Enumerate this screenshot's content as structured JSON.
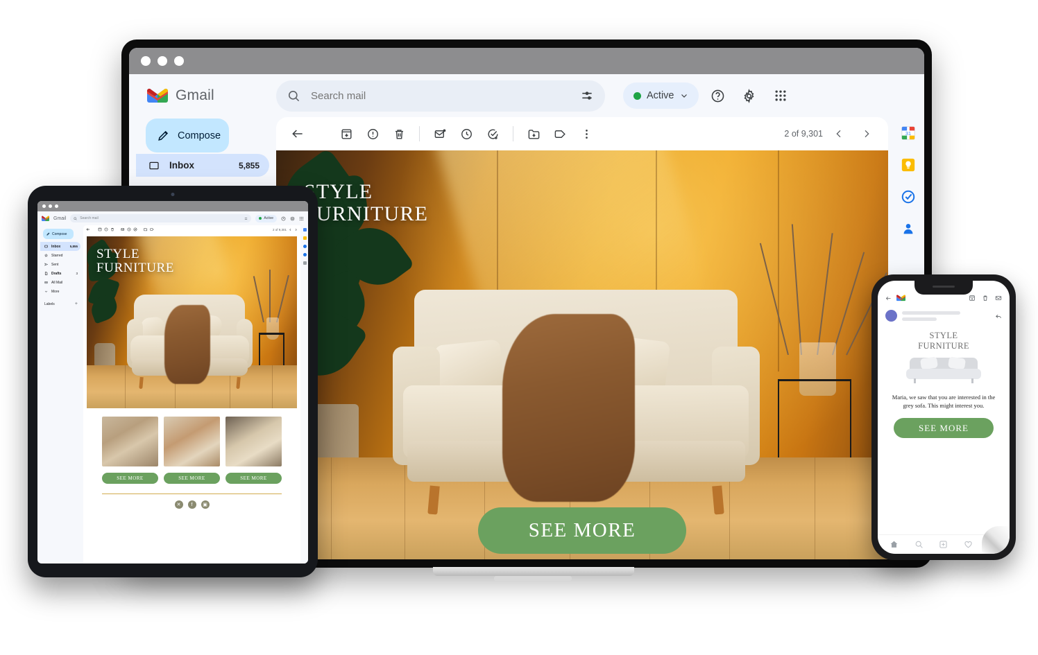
{
  "app": {
    "name": "Gmail",
    "logo_icon": "gmail-m-icon"
  },
  "search": {
    "placeholder": "Search mail",
    "value": "",
    "search_icon": "search-icon",
    "filter_icon": "filter-options-icon"
  },
  "header": {
    "status_chip": {
      "label": "Active",
      "dot_color": "#1ea446",
      "chevron_icon": "chevron-down-icon"
    },
    "help_icon": "help-circle-icon",
    "settings_icon": "gear-icon",
    "apps_icon": "google-apps-grid-icon"
  },
  "sidebar": {
    "compose": {
      "label": "Compose",
      "icon": "pencil-icon"
    },
    "items": [
      {
        "label": "Inbox",
        "icon": "inbox-icon",
        "count": "5,855",
        "selected": true
      },
      {
        "label": "Starred",
        "icon": "star-icon",
        "count": ""
      },
      {
        "label": "Sent",
        "icon": "send-icon",
        "count": ""
      },
      {
        "label": "Drafts",
        "icon": "draft-icon",
        "count": "3"
      },
      {
        "label": "All Mail",
        "icon": "all-mail-icon",
        "count": ""
      },
      {
        "label": "More",
        "icon": "chevron-down-icon",
        "count": ""
      }
    ],
    "labels_header": {
      "label": "Labels",
      "add_icon": "plus-icon"
    }
  },
  "toolbar": {
    "back_icon": "back-arrow-icon",
    "archive_icon": "archive-icon",
    "spam_icon": "report-spam-icon",
    "delete_icon": "trash-icon",
    "unread_icon": "mark-unread-icon",
    "snooze_icon": "clock-snooze-icon",
    "task_icon": "add-to-tasks-icon",
    "move_icon": "move-to-folder-icon",
    "label_icon": "label-tag-icon",
    "more_icon": "more-vertical-icon",
    "counter": "2 of 9,301",
    "prev_icon": "chevron-left-icon",
    "next_icon": "chevron-right-icon"
  },
  "rail": {
    "items": [
      {
        "name": "google-calendar-icon",
        "glyph": "31"
      },
      {
        "name": "google-keep-icon",
        "glyph": ""
      },
      {
        "name": "google-tasks-icon",
        "glyph": ""
      },
      {
        "name": "google-contacts-icon",
        "glyph": ""
      }
    ]
  },
  "email": {
    "brand_line_1": "STYLE",
    "brand_line_2": "FURNITURE",
    "cta_label": "SEE MORE",
    "cta_color": "#6ba15f",
    "accent_gold": "#d2ab4e",
    "hero_alt": "Cream sofa with brown knit throw, pillows, plant and dried branches against an amber wall"
  },
  "tablet": {
    "cards": [
      {
        "cta": "SEE MORE",
        "alt": "Tan sculptural lounge chair by a window"
      },
      {
        "cta": "SEE MORE",
        "alt": "Rounded peach armchair in sunlight"
      },
      {
        "cta": "SEE MORE",
        "alt": "Cream sheepskin swivel chair"
      }
    ],
    "social": [
      {
        "name": "x-twitter-icon",
        "glyph": "✕"
      },
      {
        "name": "facebook-icon",
        "glyph": "f"
      },
      {
        "name": "instagram-icon",
        "glyph": "▣"
      }
    ]
  },
  "phone": {
    "back_icon": "back-arrow-icon",
    "logo_icon": "gmail-m-icon",
    "archive_icon": "archive-icon",
    "delete_icon": "trash-icon",
    "mail_icon": "mail-icon",
    "reply_icon": "reply-arrow-icon",
    "brand_line_1": "STYLE",
    "brand_line_2": "FURNITURE",
    "body_copy": "Maria, we saw that you are interested in the grey sofa. This might interest you.",
    "cta_label": "SEE MORE",
    "nav": [
      {
        "name": "home-icon"
      },
      {
        "name": "search-icon"
      },
      {
        "name": "add-square-icon"
      },
      {
        "name": "heart-icon"
      },
      {
        "name": "profile-icon"
      }
    ]
  }
}
